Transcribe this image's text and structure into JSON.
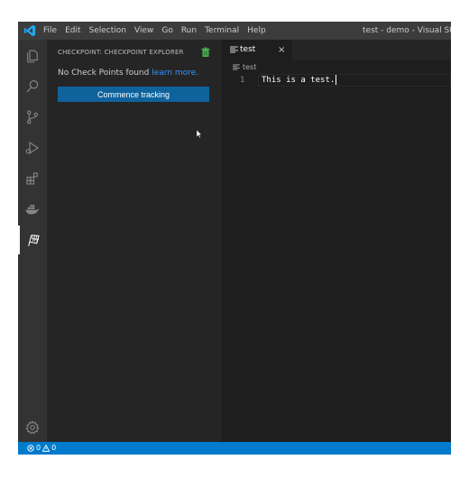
{
  "menubar": {
    "items": [
      "File",
      "Edit",
      "Selection",
      "View",
      "Go",
      "Run",
      "Terminal",
      "Help"
    ]
  },
  "window": {
    "title": "test - demo - Visual Studio Code"
  },
  "activitybar": {
    "icons": [
      "explorer-icon",
      "search-icon",
      "source-control-icon",
      "run-debug-icon",
      "extensions-icon",
      "docker-icon",
      "checkpoint-icon",
      "settings-gear-icon"
    ]
  },
  "sidebar": {
    "title": "CHECKPOINT: CHECKPOINT EXPLORER",
    "empty_message": "No Check Points found",
    "learn_more": "learn more.",
    "commence_button": "Commence tracking"
  },
  "editor": {
    "tab_label": "test",
    "tab_close": "×",
    "breadcrumb": "test",
    "line_number": "1",
    "line_text": "This is a test."
  },
  "statusbar": {
    "errors": "0",
    "warnings": "0"
  },
  "colors": {
    "accent": "#007acc",
    "button": "#0e639c",
    "link": "#3794ff",
    "trash": "#4caf50"
  }
}
